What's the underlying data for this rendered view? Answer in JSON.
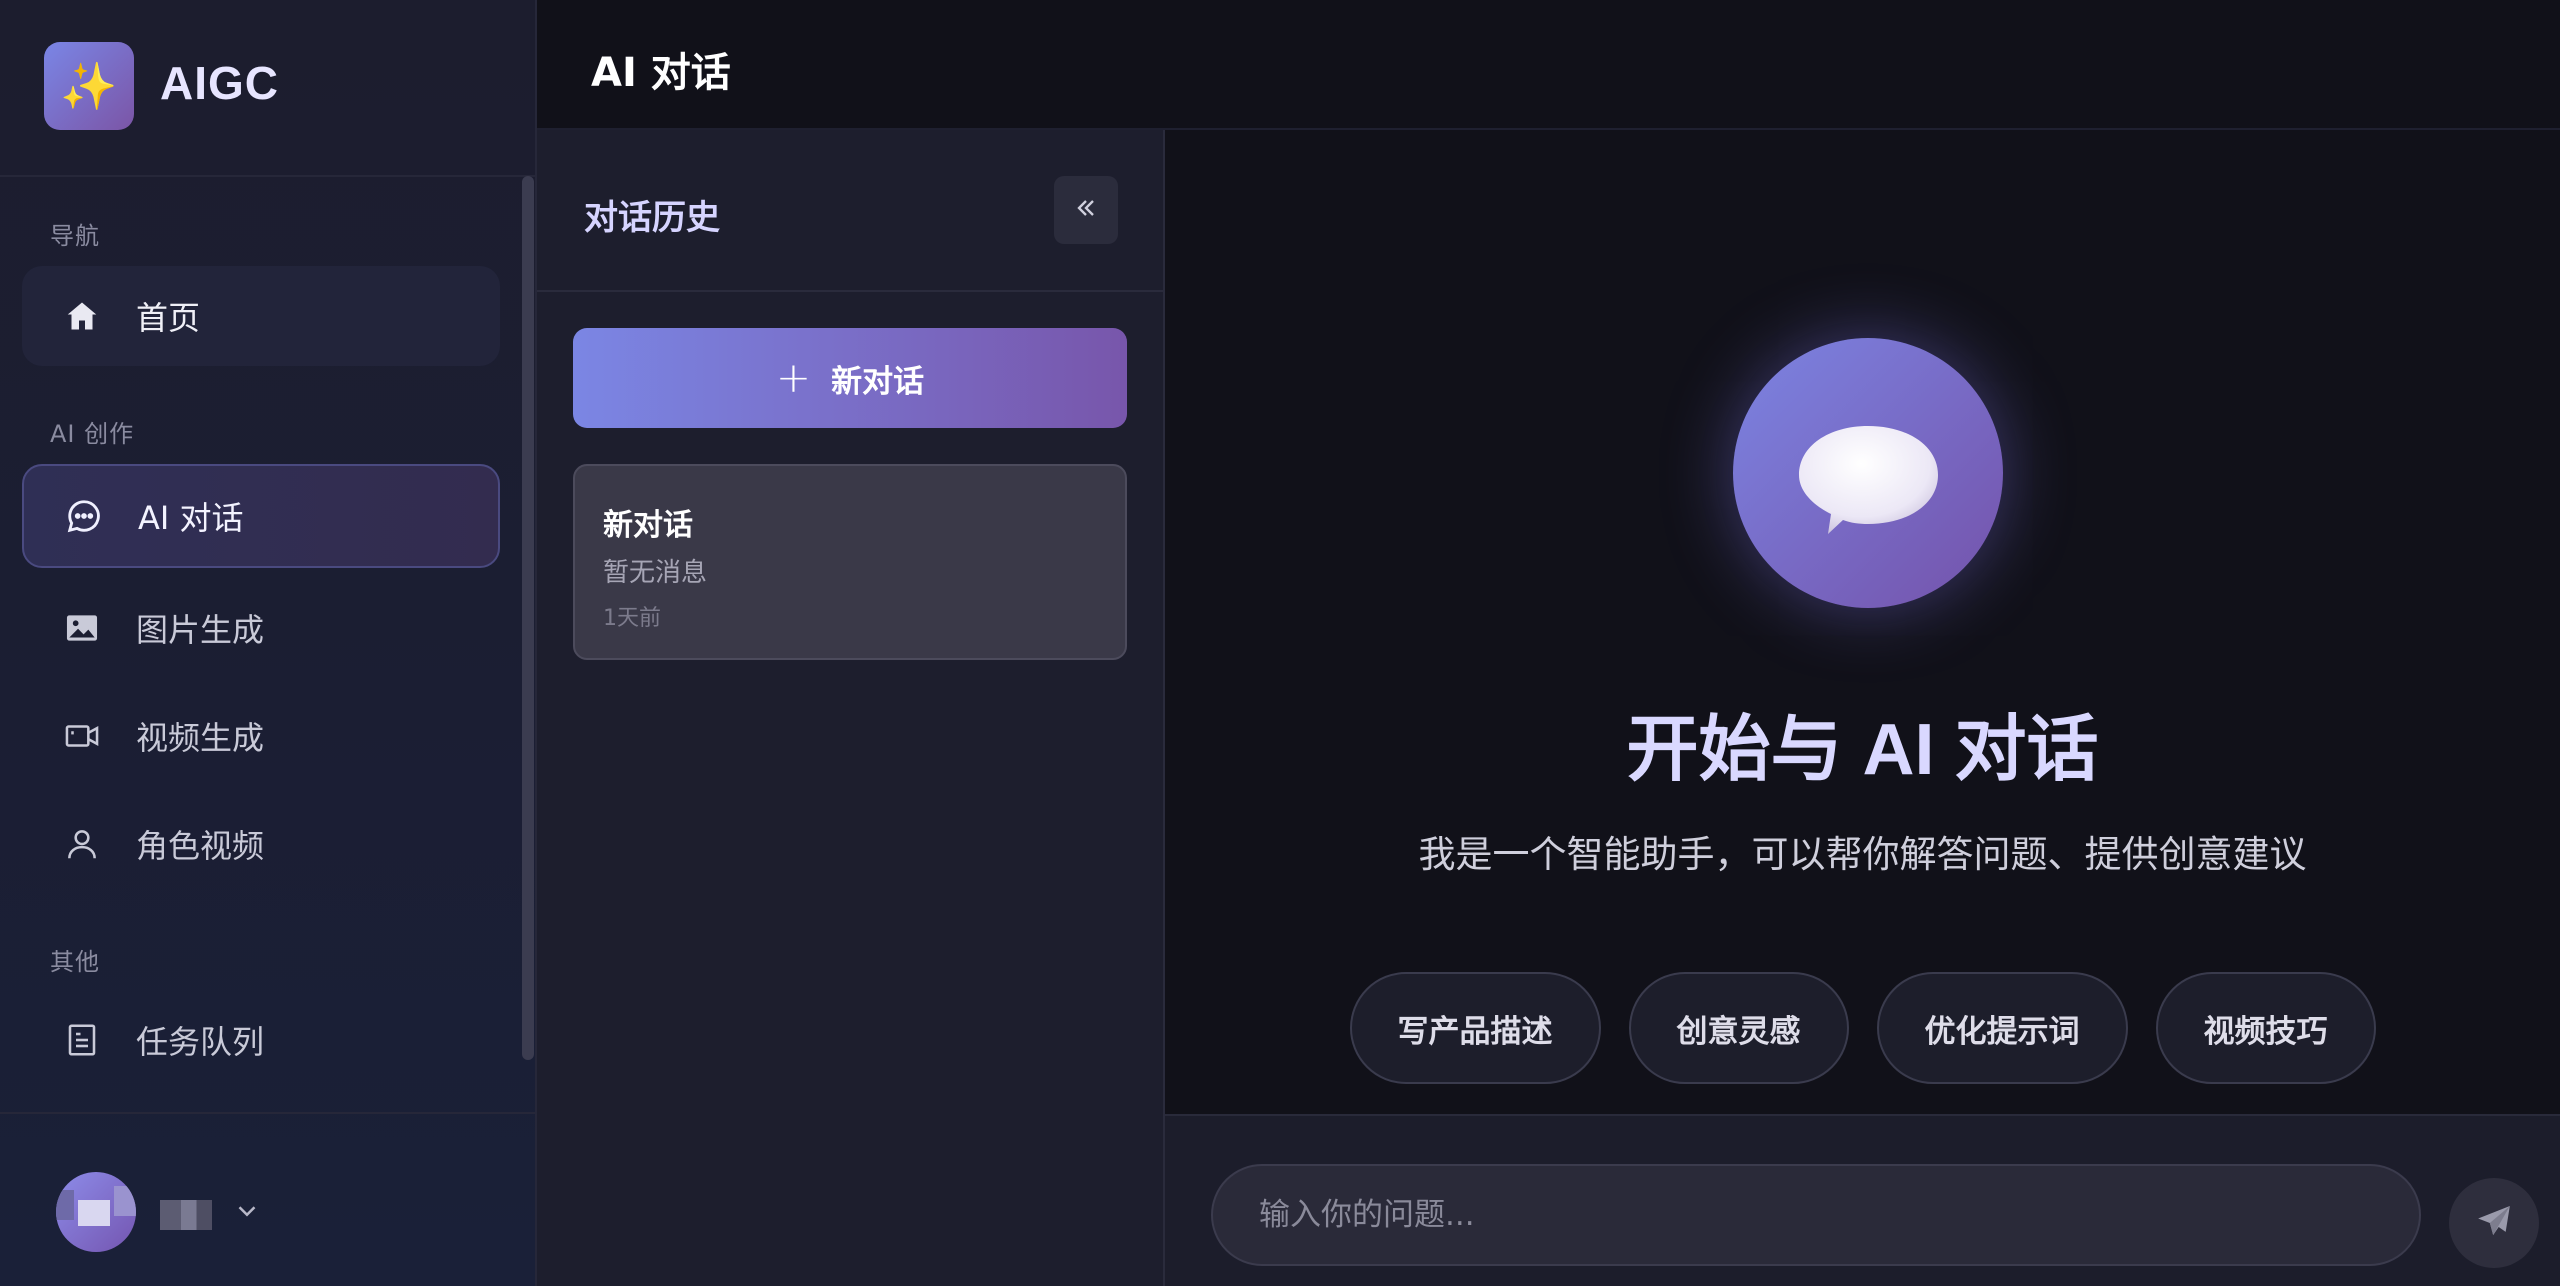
{
  "app": {
    "name": "AIGC",
    "logo_icon": "sparkles-icon"
  },
  "sidebar": {
    "sections": {
      "nav": "导航",
      "ai_create": "AI 创作",
      "other": "其他"
    },
    "items": [
      {
        "label": "首页",
        "icon": "home-icon"
      },
      {
        "label": "AI 对话",
        "icon": "chat-bubble-icon",
        "active": true
      },
      {
        "label": "图片生成",
        "icon": "image-icon"
      },
      {
        "label": "视频生成",
        "icon": "video-camera-icon"
      },
      {
        "label": "角色视频",
        "icon": "user-icon"
      },
      {
        "label": "任务队列",
        "icon": "document-list-icon"
      }
    ]
  },
  "header": {
    "title": "AI 对话"
  },
  "history": {
    "title": "对话历史",
    "new_chat_label": "新对话",
    "conversations": [
      {
        "title": "新对话",
        "last_message": "暂无消息",
        "time": "1天前"
      }
    ]
  },
  "main": {
    "title": "开始与 AI 对话",
    "subtitle": "我是一个智能助手，可以帮你解答问题、提供创意建议",
    "suggestions": [
      "写产品描述",
      "创意灵感",
      "优化提示词",
      "视频技巧"
    ]
  },
  "input": {
    "placeholder": "输入你的问题..."
  },
  "colors": {
    "accent_start": "#7b86e4",
    "accent_end": "#7856ab",
    "background": "#111119"
  }
}
